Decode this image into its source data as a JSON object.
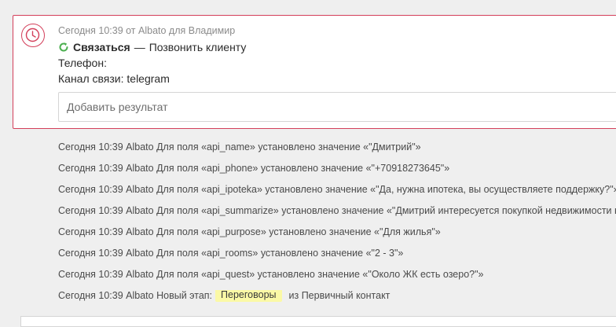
{
  "task": {
    "meta": "Сегодня 10:39 от Albato для Владимир",
    "type_label": "Связаться",
    "dash": "—",
    "description": "Позвонить клиенту",
    "phone_line": "Телефон:",
    "channel_line": "Канал связи: telegram",
    "result_placeholder": "Добавить результат",
    "icons": {
      "badge": "clock-icon",
      "status": "refresh-icon"
    },
    "colors": {
      "border": "#d33f5a",
      "status_icon": "#4caf50",
      "stage_highlight": "#fbf9a6"
    }
  },
  "feed": [
    {
      "time": "Сегодня 10:39",
      "author": "Albato",
      "text": "Для поля «api_name» установлено значение «\"Дмитрий\"»"
    },
    {
      "time": "Сегодня 10:39",
      "author": "Albato",
      "text": "Для поля «api_phone» установлено значение «\"+70918273645\"»"
    },
    {
      "time": "Сегодня 10:39",
      "author": "Albato",
      "text": "Для поля «api_ipoteka» установлено значение «\"Да, нужна ипотека, вы осуществляете поддержку?\"»"
    },
    {
      "time": "Сегодня 10:39",
      "author": "Albato",
      "text": "Для поля «api_summarize» установлено значение «\"Дмитрий интересуется покупкой недвижимости в Ж"
    },
    {
      "time": "Сегодня 10:39",
      "author": "Albato",
      "text": "Для поля «api_purpose» установлено значение «\"Для жилья\"»"
    },
    {
      "time": "Сегодня 10:39",
      "author": "Albato",
      "text": "Для поля «api_rooms» установлено значение «\"2 - 3\"»"
    },
    {
      "time": "Сегодня 10:39",
      "author": "Albato",
      "text": "Для поля «api_quest» установлено значение «\"Около ЖК есть озеро?\"»"
    }
  ],
  "stage_change": {
    "time": "Сегодня 10:39",
    "author": "Albato",
    "label": "Новый этап:",
    "new_stage": "Переговоры",
    "from_text": "из Первичный контакт"
  }
}
